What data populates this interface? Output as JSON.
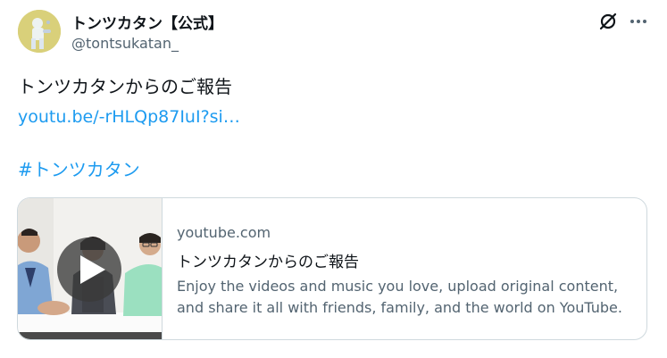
{
  "author": {
    "name": "トンツカタン【公式】",
    "handle": "@tontsukatan_",
    "avatar_icon": "avatar-illustration"
  },
  "header_icons": {
    "platform_icon": "x-logo-icon",
    "more_icon": "more-options-icon"
  },
  "tweet": {
    "text": "トンツカタンからのご報告",
    "link": "youtu.be/-rHLQp87IuI?si…",
    "hashtag": "#トンツカタン"
  },
  "card": {
    "domain": "youtube.com",
    "title": "トンツカタンからのご報告",
    "description": "Enjoy the videos and music you love, upload original content, and share it all with friends, family, and the world on YouTube.",
    "thumbnail_icon": "video-thumbnail-with-play-icon"
  },
  "colors": {
    "link": "#1d9bf0",
    "text_primary": "#0f1419",
    "text_secondary": "#536471",
    "border": "#cfd9de"
  }
}
